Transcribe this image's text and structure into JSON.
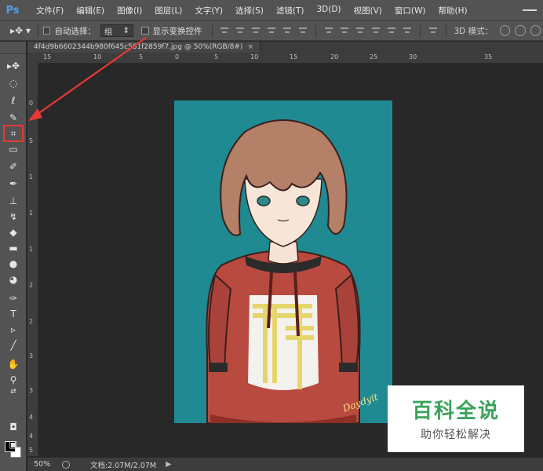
{
  "app": {
    "logo": "Ps"
  },
  "menu": {
    "items": [
      "文件(F)",
      "编辑(E)",
      "图像(I)",
      "图层(L)",
      "文字(Y)",
      "选择(S)",
      "滤镜(T)",
      "3D(D)",
      "视图(V)",
      "窗口(W)",
      "帮助(H)"
    ]
  },
  "options": {
    "auto_select_label": "自动选择：",
    "group_value": "组",
    "show_transform_label": "显示变换控件",
    "mode_3d_label": "3D 模式："
  },
  "document": {
    "tab_title": "4f4d9b6602344b980f645c581f2859f7.jpg @ 50%(RGB/8#)",
    "close_label": "×"
  },
  "rulers": {
    "horizontal": [
      "15",
      "10",
      "5",
      "0",
      "5",
      "10",
      "15",
      "20",
      "25",
      "30",
      "35"
    ],
    "vertical": [
      "0",
      "5",
      "1",
      "1",
      "1",
      "2",
      "2",
      "3",
      "3",
      "4",
      "4",
      "5"
    ]
  },
  "status": {
    "zoom": "50%",
    "doc_size": "文档:2.07M/2.07M",
    "arrow": "▶"
  },
  "watermark": {
    "title": "百科全说",
    "subtitle": "助你轻松解决"
  },
  "artwork": {
    "signature": "Daydyit",
    "background_color": "#1f8a92"
  },
  "colors": {
    "highlight": "#e53935",
    "panel": "#535353",
    "canvas_bg": "#282828"
  }
}
